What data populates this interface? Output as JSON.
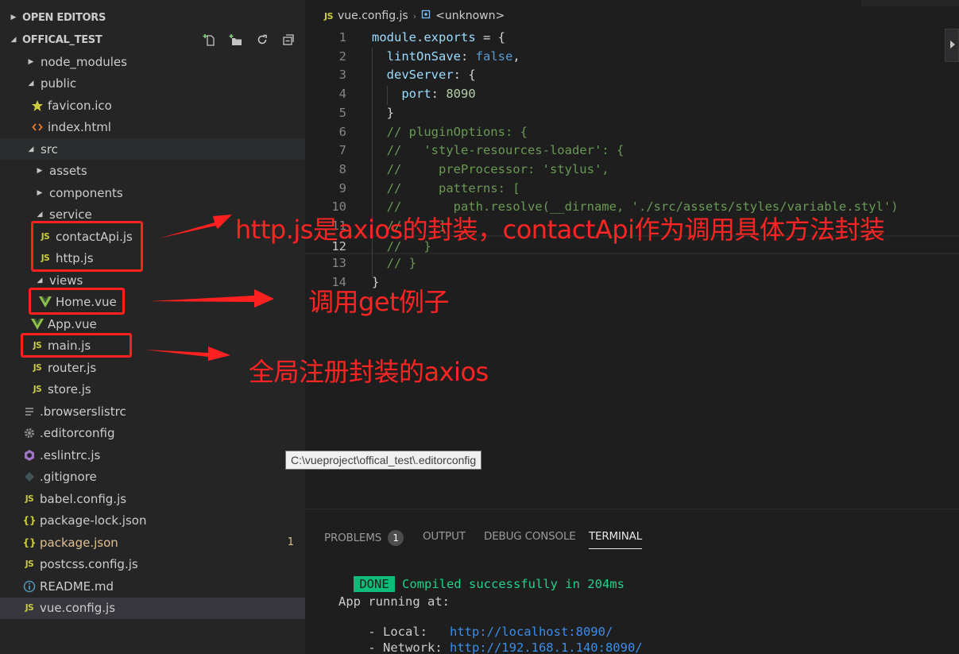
{
  "sidebar": {
    "open_editors": "OPEN EDITORS",
    "project": "OFFICAL_TEST",
    "items": [
      {
        "label": "node_modules",
        "type": "folder",
        "open": false,
        "indent": 0
      },
      {
        "label": "public",
        "type": "folder",
        "open": true,
        "indent": 0
      },
      {
        "label": "favicon.ico",
        "type": "star",
        "indent": 1
      },
      {
        "label": "index.html",
        "type": "html",
        "indent": 1
      },
      {
        "label": "src",
        "type": "folder",
        "open": true,
        "indent": 0,
        "hover": true
      },
      {
        "label": "assets",
        "type": "folder",
        "open": false,
        "indent": 1
      },
      {
        "label": "components",
        "type": "folder",
        "open": false,
        "indent": 1
      },
      {
        "label": "service",
        "type": "folder",
        "open": true,
        "indent": 1
      },
      {
        "label": "contactApi.js",
        "type": "js",
        "indent": 2
      },
      {
        "label": "http.js",
        "type": "js",
        "indent": 2
      },
      {
        "label": "views",
        "type": "folder",
        "open": true,
        "indent": 1
      },
      {
        "label": "Home.vue",
        "type": "vue",
        "indent": 2
      },
      {
        "label": "App.vue",
        "type": "vue",
        "indent": 1
      },
      {
        "label": "main.js",
        "type": "js",
        "indent": 1
      },
      {
        "label": "router.js",
        "type": "js",
        "indent": 1
      },
      {
        "label": "store.js",
        "type": "js",
        "indent": 1
      },
      {
        "label": ".browserslistrc",
        "type": "lines",
        "indent": 0
      },
      {
        "label": ".editorconfig",
        "type": "gear",
        "indent": 0
      },
      {
        "label": ".eslintrc.js",
        "type": "eslint",
        "indent": 0
      },
      {
        "label": ".gitignore",
        "type": "git",
        "indent": 0
      },
      {
        "label": "babel.config.js",
        "type": "js",
        "indent": 0
      },
      {
        "label": "package-lock.json",
        "type": "json",
        "indent": 0
      },
      {
        "label": "package.json",
        "type": "json",
        "indent": 0,
        "modified": true,
        "badge": "1"
      },
      {
        "label": "postcss.config.js",
        "type": "js",
        "indent": 0
      },
      {
        "label": "README.md",
        "type": "info",
        "indent": 0
      },
      {
        "label": "vue.config.js",
        "type": "js",
        "indent": 0,
        "selected": true
      }
    ]
  },
  "breadcrumb": {
    "file": "vue.config.js",
    "symbol": "<unknown>",
    "js_label": "JS"
  },
  "code": {
    "current_line": 12,
    "lines": [
      {
        "n": "1",
        "tokens": [
          [
            "kw",
            "module"
          ],
          [
            "pl",
            "."
          ],
          [
            "kw",
            "exports"
          ],
          [
            "pl",
            " = {"
          ]
        ]
      },
      {
        "n": "2",
        "tokens": [
          [
            "pl",
            "  "
          ],
          [
            "kw",
            "lintOnSave"
          ],
          [
            "pl",
            ": "
          ],
          [
            "bool",
            "false"
          ],
          [
            "pl",
            ","
          ]
        ]
      },
      {
        "n": "3",
        "tokens": [
          [
            "pl",
            "  "
          ],
          [
            "kw",
            "devServer"
          ],
          [
            "pl",
            ": {"
          ]
        ]
      },
      {
        "n": "4",
        "tokens": [
          [
            "pl",
            "    "
          ],
          [
            "kw",
            "port"
          ],
          [
            "pl",
            ": "
          ],
          [
            "num",
            "8090"
          ]
        ]
      },
      {
        "n": "5",
        "tokens": [
          [
            "pl",
            "  }"
          ]
        ]
      },
      {
        "n": "6",
        "tokens": [
          [
            "cm",
            "  // pluginOptions: {"
          ]
        ]
      },
      {
        "n": "7",
        "tokens": [
          [
            "cm",
            "  //   'style-resources-loader': {"
          ]
        ]
      },
      {
        "n": "8",
        "tokens": [
          [
            "cm",
            "  //     preProcessor: 'stylus',"
          ]
        ]
      },
      {
        "n": "9",
        "tokens": [
          [
            "cm",
            "  //     patterns: ["
          ]
        ]
      },
      {
        "n": "10",
        "tokens": [
          [
            "cm",
            "  //       path.resolve(__dirname, './src/assets/styles/variable.styl')"
          ]
        ]
      },
      {
        "n": "11",
        "tokens": [
          [
            "cm",
            "  //     ]"
          ]
        ]
      },
      {
        "n": "12",
        "tokens": [
          [
            "cm",
            "  //   }"
          ]
        ]
      },
      {
        "n": "13",
        "tokens": [
          [
            "cm",
            "  // }"
          ]
        ]
      },
      {
        "n": "14",
        "tokens": [
          [
            "pl",
            "}"
          ]
        ]
      }
    ]
  },
  "tooltip": "C:\\vueproject\\offical_test\\.editorconfig",
  "panel": {
    "tabs": [
      {
        "label": "PROBLEMS",
        "badge": "1",
        "active": false
      },
      {
        "label": "OUTPUT",
        "active": false
      },
      {
        "label": "DEBUG CONSOLE",
        "active": false
      },
      {
        "label": "TERMINAL",
        "active": true
      }
    ],
    "terminal": {
      "done": "DONE",
      "compiled": "Compiled successfully in 204ms",
      "running": "App running at:",
      "local_label": "- Local:   ",
      "local_url": "http://localhost:8090/",
      "network_label": "- Network: ",
      "network_url": "http://192.168.1.140:8090/"
    }
  },
  "annotations": {
    "service_note": "http.js是axios的封装，contactApi作为调用具体方法封装",
    "home_note": "调用get例子",
    "main_note": "全局注册封装的axios",
    "color": "#ff2020"
  }
}
